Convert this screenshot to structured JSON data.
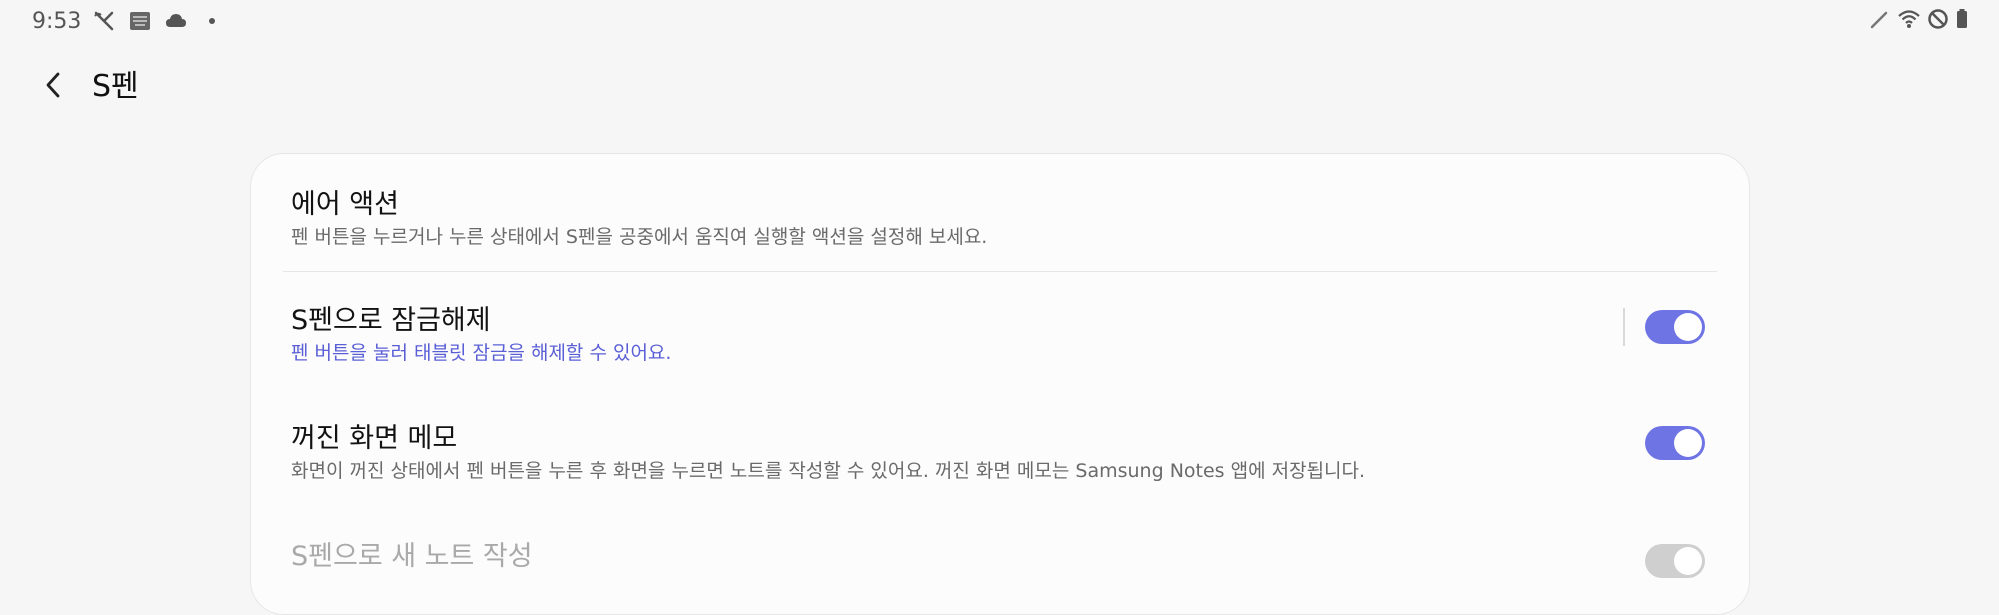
{
  "status_bar": {
    "time": "9:53",
    "left_icons": [
      "call-end-icon",
      "keyboard-icon",
      "cloud-icon",
      "dot-icon"
    ],
    "right_icons": [
      "pen-icon",
      "wifi-icon",
      "do-not-disturb-icon",
      "battery-icon"
    ]
  },
  "header": {
    "back_icon": "chevron-left-icon",
    "title": "S펜"
  },
  "settings": {
    "air_action": {
      "title": "에어 액션",
      "subtitle": "펜 버튼을 누르거나 누른 상태에서 S펜을 공중에서 움직여 실행할 액션을 설정해 보세요."
    },
    "unlock": {
      "title": "S펜으로 잠금해제",
      "subtitle": "펜 버튼을 눌러 태블릿 잠금을 해제할 수 있어요.",
      "enabled": true
    },
    "screen_off_memo": {
      "title": "꺼진 화면 메모",
      "subtitle": "화면이 꺼진 상태에서 펜 버튼을 누른 후 화면을 누르면 노트를 작성할 수 있어요. 꺼진 화면 메모는 Samsung Notes 앱에 저장됩니다.",
      "enabled": true
    },
    "new_note": {
      "title": "S펜으로 새 노트 작성",
      "enabled": false
    }
  },
  "colors": {
    "accent": "#6f74e4",
    "accent_text": "#5a5fd6",
    "toggle_disabled": "#cfcfcf",
    "background": "#f6f6f6",
    "card": "#fcfcfc"
  }
}
